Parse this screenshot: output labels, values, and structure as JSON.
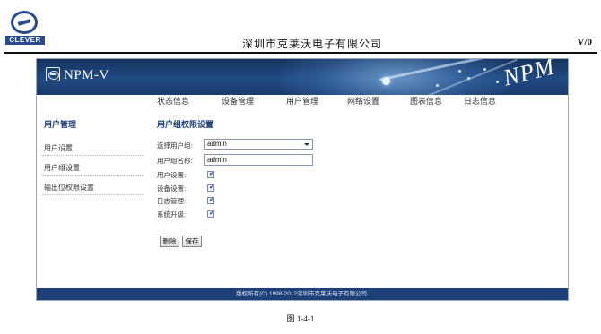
{
  "document": {
    "logo_text": "CLEVER",
    "company": "深圳市克莱沃电子有限公司",
    "version": "V/0",
    "caption": "图 1-4-1"
  },
  "app": {
    "product_name": "NPM-V",
    "brand_watermark": "NPM",
    "nav": [
      "状态信息",
      "设备管理",
      "用户管理",
      "网络设置",
      "图表信息",
      "日志信息"
    ],
    "sidebar": {
      "title": "用户管理",
      "items": [
        "用户设置",
        "用户组设置",
        "输出位权限设置"
      ]
    },
    "main": {
      "title": "用户组权限设置",
      "group_select_label": "选择用户组:",
      "group_select_value": "admin",
      "group_name_label": "用户组名称:",
      "group_name_value": "admin",
      "permissions": [
        {
          "label": "用户设置:",
          "checked": true
        },
        {
          "label": "设备设置:",
          "checked": true
        },
        {
          "label": "日志管理:",
          "checked": true
        },
        {
          "label": "系统升级:",
          "checked": true
        }
      ],
      "delete_label": "删除",
      "save_label": "保存"
    },
    "footer": "版权所有(C) 1998-2012深圳市克莱沃电子有限公司."
  }
}
